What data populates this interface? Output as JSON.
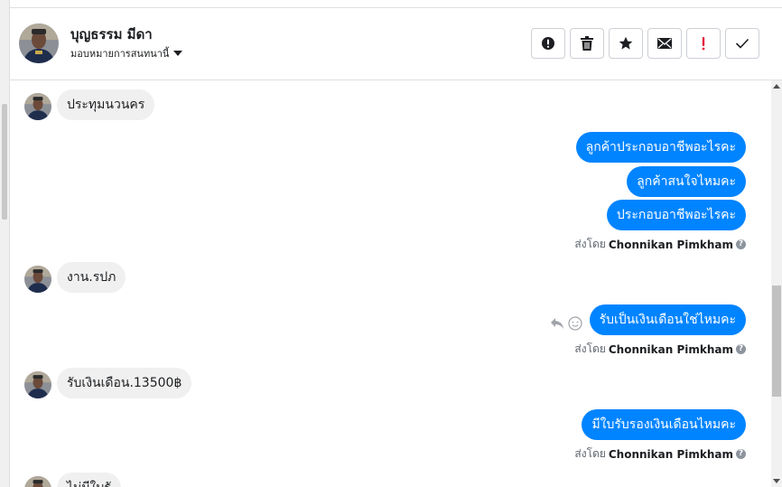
{
  "contact": {
    "name": "บุญธรรม มีดา",
    "assign_label": "มอบหมายการสนทนานี้"
  },
  "actions": [
    {
      "icon": "exclamation-circle-icon",
      "label": "Mark as spam"
    },
    {
      "icon": "trash-icon",
      "label": "Delete"
    },
    {
      "icon": "star-icon",
      "label": "Star"
    },
    {
      "icon": "envelope-icon",
      "label": "Mark as unread"
    },
    {
      "icon": "exclamation-icon",
      "label": "Follow up"
    },
    {
      "icon": "check-icon",
      "label": "Mark as done"
    }
  ],
  "messages": {
    "m1": "ประทุมนวนคร",
    "m2": "ลูกค้าประกอบอาชีพอะไรคะ",
    "m3": "ลูกค้าสนใจไหมคะ",
    "m4": "ประกอบอาชีพอะไรคะ",
    "m5": "งาน.รปภ",
    "m6": "รับเป็นเงินเดือนใช่ไหมคะ",
    "m7": "รับเงินเดือน.13500฿",
    "m8": "มีใบรับรองเงินเดือนไหมคะ",
    "m9": "ไม่มีใบรั"
  },
  "sent_by": {
    "prefix": "ส่งโดย",
    "agent": "Chonnikan Pimkham"
  },
  "colors": {
    "outgoing_bubble": "#0084ff",
    "incoming_bubble": "#f0f0f0",
    "follow_up_red": "#e41e3f"
  }
}
